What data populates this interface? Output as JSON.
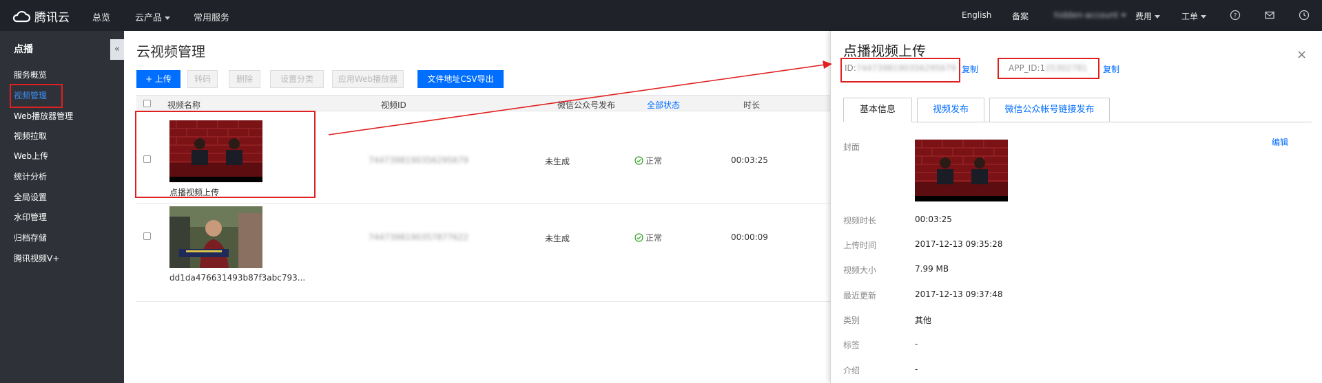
{
  "topbar": {
    "brand": "腾讯云",
    "nav": [
      "总览",
      "云产品",
      "常用服务"
    ],
    "lang": "English",
    "beian": "备案",
    "account": "hidden-account",
    "fees": "费用",
    "ticket": "工单",
    "icons": [
      "help-icon",
      "mail-icon",
      "clock-icon"
    ]
  },
  "sidebar": {
    "title": "点播",
    "collapse": "«",
    "items": [
      "服务概览",
      "视频管理",
      "Web播放器管理",
      "视频拉取",
      "Web上传",
      "统计分析",
      "全局设置",
      "水印管理",
      "归档存储",
      "腾讯视频V+"
    ],
    "active_index": 1
  },
  "main": {
    "title": "云视频管理",
    "buttons": {
      "upload": "+ 上传",
      "transcode": "转码",
      "delete": "删除",
      "category": "设置分类",
      "web_player": "应用Web播放器",
      "export": "文件地址CSV导出"
    },
    "columns": [
      "视频名称",
      "视频ID",
      "微信公众号发布",
      "全部状态",
      "时长"
    ],
    "rows": [
      {
        "name": "点播视频上传",
        "id": "7447398190356295679",
        "wechat": "未生成",
        "status": "正常",
        "duration": "00:03:25"
      },
      {
        "name": "dd1da476631493b87f3abc793...",
        "id": "7447398190357877622",
        "wechat": "未生成",
        "status": "正常",
        "duration": "00:00:09"
      }
    ]
  },
  "panel": {
    "title": "点播视频上传",
    "close": "×",
    "id_label": "ID:",
    "id_value": "7447398190356295679",
    "copy": "复制",
    "appid_label": "APP_ID:1",
    "appid_value": "25302781",
    "tabs": [
      "基本信息",
      "视频发布",
      "微信公众帐号链接发布"
    ],
    "edit": "编辑",
    "fields": [
      {
        "label": "封面",
        "value": ""
      },
      {
        "label": "视频时长",
        "value": "00:03:25"
      },
      {
        "label": "上传时间",
        "value": "2017-12-13 09:35:28"
      },
      {
        "label": "视频大小",
        "value": "7.99 MB"
      },
      {
        "label": "最近更新",
        "value": "2017-12-13 09:37:48"
      },
      {
        "label": "类别",
        "value": "其他"
      },
      {
        "label": "标签",
        "value": "-"
      },
      {
        "label": "介绍",
        "value": "-"
      }
    ]
  },
  "colors": {
    "topbar": "#1f2329",
    "sidebar": "#2e3238",
    "accent": "#006eff",
    "annotation": "#e02020"
  }
}
